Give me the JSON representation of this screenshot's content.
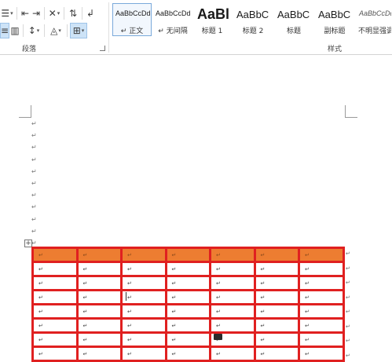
{
  "ribbon": {
    "paragraph_group": {
      "label": "段落",
      "row1_icons": [
        "list-multilevel-icon",
        "decrease-indent-icon",
        "increase-indent-icon",
        "chinese-layout-icon",
        "sort-icon",
        "show-marks-icon"
      ],
      "row2_icons": [
        "justify-icon",
        "distributed-icon",
        "line-spacing-icon",
        "shading-icon",
        "borders-icon"
      ]
    },
    "styles_group": {
      "label": "样式",
      "items": [
        {
          "sample": "AaBbCcDd",
          "name": "↵ 正文",
          "selected": true
        },
        {
          "sample": "AaBbCcDd",
          "name": "↵ 无间隔",
          "selected": false
        },
        {
          "sample": "AaBl",
          "name": "标题 1",
          "selected": false
        },
        {
          "sample": "AaBbC",
          "name": "标题 2",
          "selected": false
        },
        {
          "sample": "AaBbC",
          "name": "标题",
          "selected": false
        },
        {
          "sample": "AaBbC",
          "name": "副标题",
          "selected": false
        },
        {
          "sample": "AaBbCcDd",
          "name": "不明显强调",
          "selected": false
        }
      ]
    }
  },
  "document": {
    "paragraph_mark": "↵",
    "empty_paragraph_count": 11,
    "table": {
      "header_color": "#ED7D31",
      "border_color": "#E02020",
      "rows": [
        [
          "↵",
          "↵",
          "↵",
          "↵",
          "↵",
          "↵",
          "↵"
        ],
        [
          "↵",
          "↵",
          "↵",
          "↵",
          "↵",
          "↵",
          "↵"
        ],
        [
          "↵",
          "↵",
          "↵",
          "↵",
          "↵",
          "↵",
          "↵"
        ],
        [
          "↵",
          "↵",
          "↵",
          "↵",
          "↵",
          "↵",
          "↵"
        ],
        [
          "↵",
          "↵",
          "↵",
          "↵",
          "↵",
          "↵",
          "↵"
        ],
        [
          "↵",
          "↵",
          "↵",
          "↵",
          "↵",
          "↵",
          "↵"
        ],
        [
          "↵",
          "↵",
          "↵",
          "↵",
          "↵",
          "↵",
          "↵"
        ],
        [
          "↵",
          "↵",
          "↵",
          "↵",
          "↵",
          "↵",
          "↵"
        ]
      ],
      "row_end_mark": "↵",
      "move_handle": "+"
    }
  }
}
